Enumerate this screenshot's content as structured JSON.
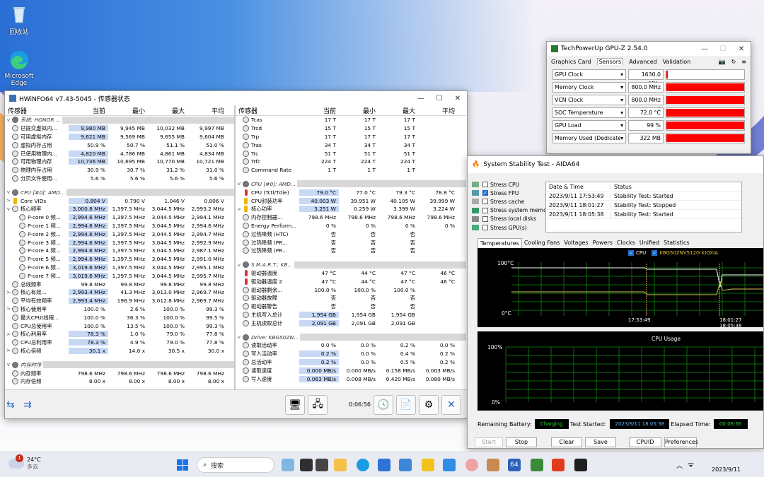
{
  "desktop": {
    "icons": [
      {
        "label": "回收站",
        "icon": "recycle-bin-icon"
      },
      {
        "label": "Microsoft Edge",
        "icon": "edge-icon"
      }
    ]
  },
  "hwinfo": {
    "title": "HWiNFO64 v7.43-5045 - 传感器状态",
    "headers": [
      "传感器",
      "当前",
      "最小",
      "最大",
      "平均"
    ],
    "left_rows": [
      {
        "type": "group",
        "name": "系统: HONOR ..."
      },
      {
        "name": "已提交虚拟内...",
        "v": [
          "9,980 MB",
          "9,945 MB",
          "10,032 MB",
          "9,997 MB"
        ],
        "hl": true
      },
      {
        "name": "可用虚拟内存",
        "v": [
          "9,621 MB",
          "9,569 MB",
          "9,655 MB",
          "9,604 MB"
        ],
        "hl": true
      },
      {
        "name": "虚拟内存占用",
        "v": [
          "50.9 %",
          "50.7 %",
          "51.1 %",
          "51.0 %"
        ]
      },
      {
        "name": "已使用物理内...",
        "v": [
          "4,820 MB",
          "4,786 MB",
          "4,861 MB",
          "4,834 MB"
        ],
        "hl": true
      },
      {
        "name": "可用物理内存",
        "v": [
          "10,736 MB",
          "10,695 MB",
          "10,770 MB",
          "10,721 MB"
        ],
        "hl": true
      },
      {
        "name": "物理内存占用",
        "v": [
          "30.9 %",
          "30.7 %",
          "31.2 %",
          "31.0 %"
        ]
      },
      {
        "name": "分页文件使用...",
        "v": [
          "5.6 %",
          "5.6 %",
          "5.6 %",
          "5.6 %"
        ]
      },
      {
        "type": "sep"
      },
      {
        "type": "group",
        "name": "CPU [#0]: AMD..."
      },
      {
        "name": "Core VIDs",
        "v": [
          "0.804 V",
          "0.790 V",
          "1.046 V",
          "0.806 V"
        ],
        "hl": true,
        "exp": ">",
        "ico": "voltage"
      },
      {
        "name": "核心频率",
        "v": [
          "3,000.8 MHz",
          "1,397.5 MHz",
          "3,044.5 MHz",
          "2,993.2 MHz"
        ],
        "hl": true,
        "exp": "v"
      },
      {
        "name": "P-core 0 频...",
        "v": [
          "2,994.6 MHz",
          "1,397.5 MHz",
          "3,044.5 MHz",
          "2,994.1 MHz"
        ],
        "hl": true,
        "ind": true
      },
      {
        "name": "P-core 1 频...",
        "v": [
          "2,994.6 MHz",
          "1,397.5 MHz",
          "3,044.5 MHz",
          "2,994.6 MHz"
        ],
        "hl": true,
        "ind": true
      },
      {
        "name": "P-core 2 频...",
        "v": [
          "2,994.6 MHz",
          "1,397.5 MHz",
          "3,044.5 MHz",
          "2,994.7 MHz"
        ],
        "hl": true,
        "ind": true
      },
      {
        "name": "P-core 3 频...",
        "v": [
          "2,994.6 MHz",
          "1,397.5 MHz",
          "3,044.5 MHz",
          "2,992.9 MHz"
        ],
        "hl": true,
        "ind": true
      },
      {
        "name": "P-core 4 频...",
        "v": [
          "2,994.6 MHz",
          "1,397.5 MHz",
          "3,044.5 MHz",
          "2,987.1 MHz"
        ],
        "hl": true,
        "ind": true
      },
      {
        "name": "P-core 5 频...",
        "v": [
          "2,994.6 MHz",
          "1,397.5 MHz",
          "3,044.5 MHz",
          "2,991.0 MHz"
        ],
        "hl": true,
        "ind": true
      },
      {
        "name": "P-core 6 频...",
        "v": [
          "3,019.6 MHz",
          "1,397.5 MHz",
          "3,044.5 MHz",
          "2,995.1 MHz"
        ],
        "hl": true,
        "ind": true
      },
      {
        "name": "P-core 7 频...",
        "v": [
          "3,019.6 MHz",
          "1,397.5 MHz",
          "3,044.5 MHz",
          "2,995.7 MHz"
        ],
        "hl": true,
        "ind": true
      },
      {
        "name": "总线频率",
        "v": [
          "99.8 MHz",
          "99.8 MHz",
          "99.8 MHz",
          "99.8 MHz"
        ]
      },
      {
        "name": "核心有效...",
        "v": [
          "2,993.4 MHz",
          "41.3 MHz",
          "3,013.0 MHz",
          "2,969.7 MHz"
        ],
        "hl": true,
        "exp": ">"
      },
      {
        "name": "平均有效频率",
        "v": [
          "2,993.4 MHz",
          "196.9 MHz",
          "3,012.8 MHz",
          "2,969.7 MHz"
        ],
        "hl": true
      },
      {
        "name": "核心使用率",
        "v": [
          "100.0 %",
          "2.6 %",
          "100.0 %",
          "99.3 %"
        ],
        "exp": ">"
      },
      {
        "name": "最大CPU/线程...",
        "v": [
          "100.0 %",
          "36.3 %",
          "100.0 %",
          "99.5 %"
        ]
      },
      {
        "name": "CPU总使用率",
        "v": [
          "100.0 %",
          "13.5 %",
          "100.0 %",
          "99.3 %"
        ]
      },
      {
        "name": "核心利用率",
        "v": [
          "78.3 %",
          "1.0 %",
          "79.0 %",
          "77.8 %"
        ],
        "hl": true,
        "exp": ">"
      },
      {
        "name": "CPU总利用率",
        "v": [
          "78.3 %",
          "4.9 %",
          "79.0 %",
          "77.8 %"
        ],
        "hl": true
      },
      {
        "name": "核心倍频",
        "v": [
          "30.1 x",
          "14.0 x",
          "30.5 x",
          "30.0 x"
        ],
        "hl": true,
        "exp": ">"
      },
      {
        "type": "sep"
      },
      {
        "type": "group",
        "name": "内存时序"
      },
      {
        "name": "内存频率",
        "v": [
          "798.6 MHz",
          "798.6 MHz",
          "798.6 MHz",
          "798.6 MHz"
        ]
      },
      {
        "name": "内存倍频",
        "v": [
          "8.00 x",
          "8.00 x",
          "8.00 x",
          "8.00 x"
        ]
      }
    ],
    "right_rows": [
      {
        "name": "Tcas",
        "v": [
          "17 T",
          "17 T",
          "17 T",
          ""
        ]
      },
      {
        "name": "Trcd",
        "v": [
          "15 T",
          "15 T",
          "15 T",
          ""
        ]
      },
      {
        "name": "Trp",
        "v": [
          "17 T",
          "17 T",
          "17 T",
          ""
        ]
      },
      {
        "name": "Tras",
        "v": [
          "34 T",
          "34 T",
          "34 T",
          ""
        ]
      },
      {
        "name": "Trc",
        "v": [
          "51 T",
          "51 T",
          "51 T",
          ""
        ]
      },
      {
        "name": "Trfc",
        "v": [
          "224 T",
          "224 T",
          "224 T",
          ""
        ]
      },
      {
        "name": "Command Rate",
        "v": [
          "1 T",
          "1 T",
          "1 T",
          ""
        ]
      },
      {
        "type": "sep"
      },
      {
        "type": "group",
        "name": "CPU [#0]: AMD..."
      },
      {
        "name": "CPU (Tctl/Tdie)",
        "v": [
          "79.0 °C",
          "77.0 °C",
          "79.3 °C",
          "78.8 °C"
        ],
        "hl": true,
        "ico": "temp"
      },
      {
        "name": "CPU封装功率",
        "v": [
          "40.003 W",
          "39.951 W",
          "40.105 W",
          "39.999 W"
        ],
        "hl": true,
        "ico": "power"
      },
      {
        "name": "核心功率",
        "v": [
          "3.251 W",
          "0.259 W",
          "3.399 W",
          "3.224 W"
        ],
        "hl": true,
        "exp": ">",
        "ico": "power"
      },
      {
        "name": "内存控制器...",
        "v": [
          "798.6 MHz",
          "798.6 MHz",
          "798.6 MHz",
          "798.6 MHz"
        ]
      },
      {
        "name": "Energy Perform...",
        "v": [
          "0 %",
          "0 %",
          "0 %",
          "0 %"
        ]
      },
      {
        "name": "过热降频 (HTC)",
        "v": [
          "否",
          "否",
          "否",
          ""
        ]
      },
      {
        "name": "过热降频 (PR...",
        "v": [
          "否",
          "否",
          "否",
          ""
        ]
      },
      {
        "name": "过热降频 (PR...",
        "v": [
          "否",
          "否",
          "否",
          ""
        ]
      },
      {
        "type": "sep"
      },
      {
        "type": "group",
        "name": "S.M.A.R.T.: KB..."
      },
      {
        "name": "驱动器温度",
        "v": [
          "47 °C",
          "44 °C",
          "47 °C",
          "46 °C"
        ],
        "ico": "temp"
      },
      {
        "name": "驱动器温度 2",
        "v": [
          "47 °C",
          "44 °C",
          "47 °C",
          "46 °C"
        ],
        "ico": "temp"
      },
      {
        "name": "驱动器剩余...",
        "v": [
          "100.0 %",
          "100.0 %",
          "100.0 %",
          ""
        ]
      },
      {
        "name": "驱动器故障",
        "v": [
          "否",
          "否",
          "否",
          ""
        ]
      },
      {
        "name": "驱动器警告",
        "v": [
          "否",
          "否",
          "否",
          ""
        ]
      },
      {
        "name": "主机写入总计",
        "v": [
          "1,954 GB",
          "1,954 GB",
          "1,954 GB",
          ""
        ],
        "hl": true
      },
      {
        "name": "主机读取总计",
        "v": [
          "2,091 GB",
          "2,091 GB",
          "2,091 GB",
          ""
        ],
        "hl": true
      },
      {
        "type": "sep"
      },
      {
        "type": "group",
        "name": "Drive: KBG50ZN..."
      },
      {
        "name": "读取活动率",
        "v": [
          "0.0 %",
          "0.0 %",
          "0.2 %",
          "0.0 %"
        ]
      },
      {
        "name": "写入活动率",
        "v": [
          "0.2 %",
          "0.0 %",
          "0.4 %",
          "0.2 %"
        ],
        "hl": true
      },
      {
        "name": "总活动率",
        "v": [
          "0.2 %",
          "0.0 %",
          "0.5 %",
          "0.2 %"
        ],
        "hl": true
      },
      {
        "name": "读取速度",
        "v": [
          "0.000 MB/s",
          "0.000 MB/s",
          "0.158 MB/s",
          "0.003 MB/s"
        ],
        "hl": true
      },
      {
        "name": "写入速度",
        "v": [
          "0.063 MB/s",
          "0.008 MB/s",
          "0.420 MB/s",
          "0.080 MB/s"
        ],
        "hl": true
      }
    ],
    "toolbar": {
      "timer": "0:06:56"
    }
  },
  "gpuz": {
    "title": "TechPowerUp GPU-Z 2.54.0",
    "tabs": [
      "Graphics Card",
      "Sensors",
      "Advanced",
      "Validation"
    ],
    "sensors": [
      {
        "label": "GPU Clock",
        "value": "1630.0 MHz",
        "fill": 0.02
      },
      {
        "label": "Memory Clock",
        "value": "800.0 MHz",
        "fill": 1.0
      },
      {
        "label": "VCN Clock",
        "value": "800.0 MHz",
        "fill": 1.0
      },
      {
        "label": "SOC Temperature",
        "value": "72.0 °C",
        "fill": 1.0
      },
      {
        "label": "GPU Load",
        "value": "99 %",
        "fill": 1.0
      },
      {
        "label": "Memory Used (Dedicated)",
        "value": "322 MB",
        "fill": 1.0
      }
    ]
  },
  "aida": {
    "title": "System Stability Test - AIDA64",
    "stress": [
      {
        "label": "Stress CPU",
        "checked": false
      },
      {
        "label": "Stress FPU",
        "checked": true
      },
      {
        "label": "Stress cache",
        "checked": false
      },
      {
        "label": "Stress system memo",
        "checked": false
      },
      {
        "label": "Stress local disks",
        "checked": false
      },
      {
        "label": "Stress GPU(s)",
        "checked": false
      }
    ],
    "events_header": [
      "Date & Time",
      "Status"
    ],
    "events": [
      [
        "2023/9/11 17:53:49",
        "Stability Test: Started"
      ],
      [
        "2023/9/11 18:01:27",
        "Stability Test: Stopped"
      ],
      [
        "2023/9/11 18:05:38",
        "Stability Test: Started"
      ]
    ],
    "tabs": [
      "Temperatures",
      "Cooling Fans",
      "Voltages",
      "Powers",
      "Clocks",
      "Unified",
      "Statistics"
    ],
    "temp_graph": {
      "legend_cpu": "CPU",
      "legend_disk": "KBG50ZNV512G KIOXIA",
      "y_top": "100°C",
      "y_bottom": "0°C",
      "x_left": "17:53:49",
      "x_right": "18:01:27 18:05:38"
    },
    "usage_graph": {
      "title": "CPU Usage",
      "y_top": "100%",
      "y_bottom": "0%"
    },
    "bottom": {
      "battery_label": "Remaining Battery:",
      "battery_value": "Charging",
      "started_label": "Test Started:",
      "started_value": "2023/9/11 18:05:38",
      "elapsed_label": "Elapsed Time:",
      "elapsed_value": "00:06:56"
    },
    "buttons": [
      "Start",
      "Stop",
      "Clear",
      "Save",
      "CPUID",
      "Preferences"
    ]
  },
  "taskbar": {
    "weather_temp": "24°C",
    "weather_desc": "多云",
    "search": "搜索",
    "date": "2023/9/11",
    "badge": "1"
  }
}
